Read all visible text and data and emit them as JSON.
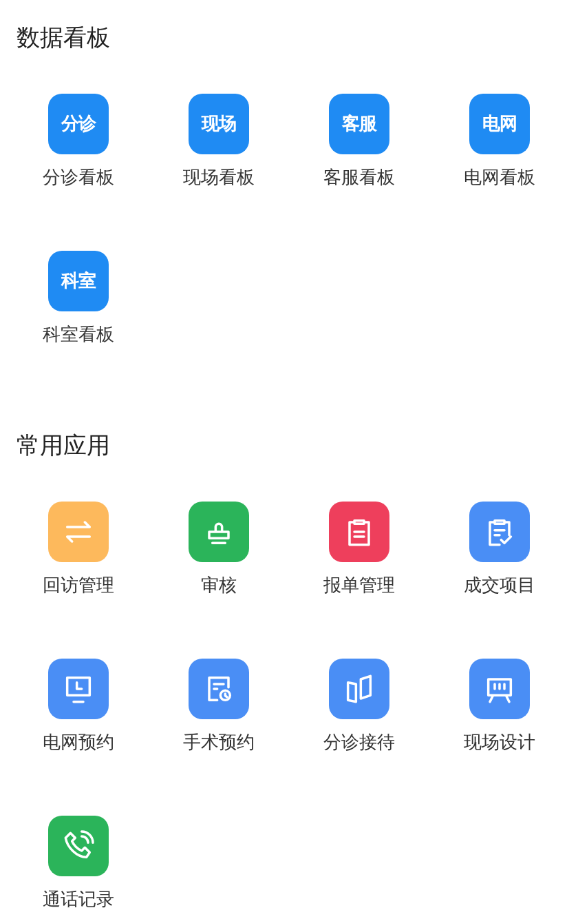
{
  "sections": [
    {
      "title": "数据看板",
      "items": [
        {
          "label": "分诊看板",
          "badge": "分诊"
        },
        {
          "label": "现场看板",
          "badge": "现场"
        },
        {
          "label": "客服看板",
          "badge": "客服"
        },
        {
          "label": "电网看板",
          "badge": "电网"
        },
        {
          "label": "科室看板",
          "badge": "科室"
        }
      ]
    },
    {
      "title": "常用应用",
      "items": [
        {
          "label": "回访管理",
          "kind": "swap",
          "color": "#fdb95c"
        },
        {
          "label": "审核",
          "kind": "stamp",
          "color": "#2bb45a"
        },
        {
          "label": "报单管理",
          "kind": "clipboard",
          "color": "#ee3f5c"
        },
        {
          "label": "成交项目",
          "kind": "checklist",
          "color": "#4a8ef5"
        },
        {
          "label": "电网预约",
          "kind": "monitor",
          "color": "#4a8ef5"
        },
        {
          "label": "手术预约",
          "kind": "schedule",
          "color": "#4a8ef5"
        },
        {
          "label": "分诊接待",
          "kind": "map",
          "color": "#4a8ef5"
        },
        {
          "label": "现场设计",
          "kind": "easel",
          "color": "#4a8ef5"
        },
        {
          "label": "通话记录",
          "kind": "phone",
          "color": "#2bb45a"
        }
      ]
    }
  ]
}
